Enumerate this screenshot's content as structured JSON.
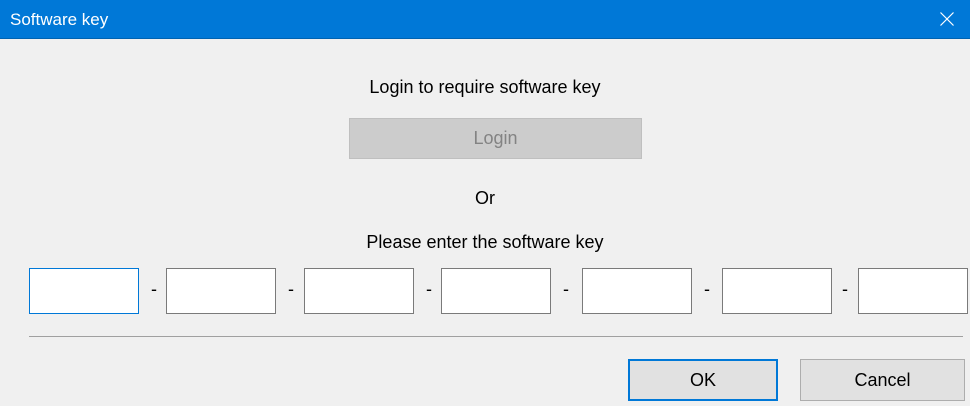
{
  "window": {
    "title": "Software key"
  },
  "content": {
    "login_prompt": "Login to require software key",
    "login_button": "Login",
    "or_text": "Or",
    "enter_prompt": "Please enter the software key"
  },
  "key_fields": [
    {
      "value": ""
    },
    {
      "value": ""
    },
    {
      "value": ""
    },
    {
      "value": ""
    },
    {
      "value": ""
    },
    {
      "value": ""
    },
    {
      "value": ""
    }
  ],
  "separator_text": "-",
  "buttons": {
    "ok": "OK",
    "cancel": "Cancel"
  },
  "colors": {
    "titlebar": "#0078d7",
    "background": "#f0f0f0",
    "focus": "#0078d7",
    "disabled_button": "#cccccc"
  }
}
